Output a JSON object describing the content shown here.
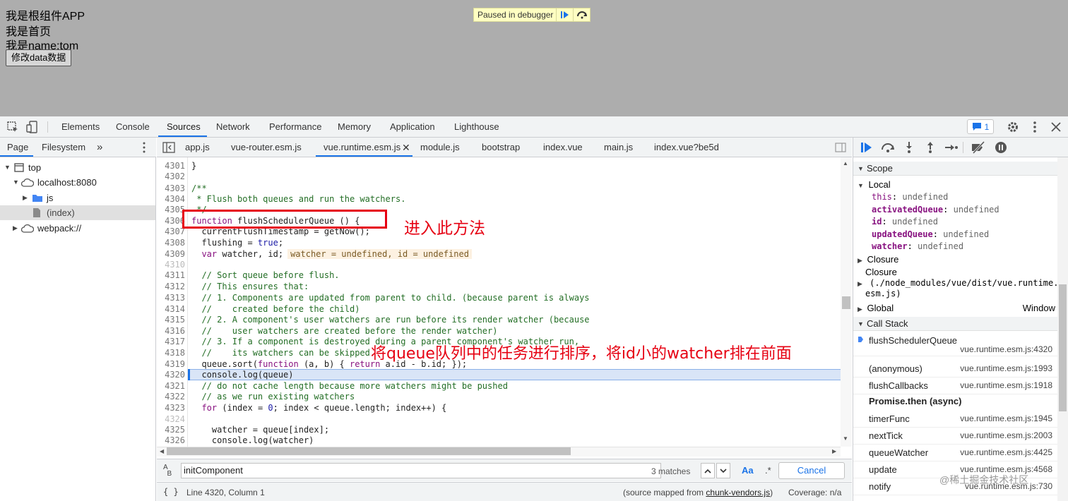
{
  "page": {
    "lines": [
      "我是根组件APP",
      "我是首页",
      "我是name:tom"
    ],
    "button_label": "修改data数据",
    "paused_banner": "Paused in debugger"
  },
  "devtools": {
    "tabs": [
      "Elements",
      "Console",
      "Sources",
      "Network",
      "Performance",
      "Memory",
      "Application",
      "Lighthouse"
    ],
    "active_tab": "Sources",
    "issues_count": "1"
  },
  "navigator": {
    "tabs": [
      "Page",
      "Filesystem"
    ],
    "more": "»",
    "tree": [
      {
        "label": "top"
      },
      {
        "label": "localhost:8080"
      },
      {
        "label": "js"
      },
      {
        "label": "(index)"
      },
      {
        "label": "webpack://"
      }
    ]
  },
  "editor": {
    "tabs": [
      "app.js",
      "vue-router.esm.js",
      "vue.runtime.esm.js",
      "module.js",
      "bootstrap",
      "index.vue",
      "main.js",
      "index.vue?be5d"
    ],
    "active_tab": "vue.runtime.esm.js",
    "lines": [
      {
        "n": "4301",
        "t": "}"
      },
      {
        "n": "4302",
        "t": ""
      },
      {
        "n": "4303",
        "t": "/**"
      },
      {
        "n": "4304",
        "t": " * Flush both queues and run the watchers."
      },
      {
        "n": "4305",
        "t": " */"
      },
      {
        "n": "4306",
        "t": "function flushSchedulerQueue () {"
      },
      {
        "n": "4307",
        "t": "  currentFlushTimestamp = getNow();"
      },
      {
        "n": "4308",
        "t": "  flushing = true;"
      },
      {
        "n": "4309",
        "t": "  var watcher, id;"
      },
      {
        "n": "4310",
        "t": ""
      },
      {
        "n": "4311",
        "t": "  // Sort queue before flush."
      },
      {
        "n": "4312",
        "t": "  // This ensures that:"
      },
      {
        "n": "4313",
        "t": "  // 1. Components are updated from parent to child. (because parent is always"
      },
      {
        "n": "4314",
        "t": "  //    created before the child)"
      },
      {
        "n": "4315",
        "t": "  // 2. A component's user watchers are run before its render watcher (because"
      },
      {
        "n": "4316",
        "t": "  //    user watchers are created before the render watcher)"
      },
      {
        "n": "4317",
        "t": "  // 3. If a component is destroyed during a parent component's watcher run,"
      },
      {
        "n": "4318",
        "t": "  //    its watchers can be skipped."
      },
      {
        "n": "4319",
        "t": "  queue.sort(function (a, b) { return a.id - b.id; });"
      },
      {
        "n": "4320",
        "t": "  console.log(queue)"
      },
      {
        "n": "4321",
        "t": "  // do not cache length because more watchers might be pushed"
      },
      {
        "n": "4322",
        "t": "  // as we run existing watchers"
      },
      {
        "n": "4323",
        "t": "  for (index = 0; index < queue.length; index++) {"
      },
      {
        "n": "4324",
        "t": ""
      },
      {
        "n": "4325",
        "t": "    watcher = queue[index];"
      },
      {
        "n": "4326",
        "t": "    console.log(watcher)"
      }
    ],
    "inline_value": "watcher = undefined, id = undefined"
  },
  "search": {
    "value": "initComponent",
    "matches": "3 matches",
    "case_label": "Aa",
    "regex_label": ".*",
    "cancel_label": "Cancel"
  },
  "status": {
    "position": "Line 4320, Column 1",
    "source_map_prefix": "(source mapped from ",
    "source_map_file": "chunk-vendors.js",
    "source_map_suffix": ")",
    "coverage": "Coverage: n/a"
  },
  "scope": {
    "header": "Scope",
    "local_header": "Local",
    "locals": [
      {
        "name": "this",
        "value": "undefined",
        "bold": false
      },
      {
        "name": "activatedQueue",
        "value": "undefined",
        "bold": true
      },
      {
        "name": "id",
        "value": "undefined",
        "bold": true
      },
      {
        "name": "updatedQueue",
        "value": "undefined",
        "bold": true
      },
      {
        "name": "watcher",
        "value": "undefined",
        "bold": true
      }
    ],
    "closure1": "Closure",
    "closure2_title": "Closure",
    "closure2_line1": "(./node_modules/vue/dist/vue.runtime.",
    "closure2_line2": "esm.js)",
    "global": "Global",
    "global_value": "Window"
  },
  "call_stack": {
    "header": "Call Stack",
    "frames": [
      {
        "fn": "flushSchedulerQueue",
        "loc": "vue.runtime.esm.js:4320"
      },
      {
        "fn": "(anonymous)",
        "loc": "vue.runtime.esm.js:1993"
      },
      {
        "fn": "flushCallbacks",
        "loc": "vue.runtime.esm.js:1918"
      },
      {
        "fn": "timerFunc",
        "loc": "vue.runtime.esm.js:1945"
      },
      {
        "fn": "nextTick",
        "loc": "vue.runtime.esm.js:2003"
      },
      {
        "fn": "queueWatcher",
        "loc": "vue.runtime.esm.js:4425"
      },
      {
        "fn": "update",
        "loc": "vue.runtime.esm.js:4568"
      },
      {
        "fn": "notify",
        "loc": "vue.runtime.esm.js:730"
      }
    ],
    "async_label": "Promise.then (async)"
  },
  "annotations": {
    "enter_method": "进入此方法",
    "sort_note": "将queue队列中的任务进行排序，将id小的watcher排在前面",
    "watermark": "@稀土掘金技术社区"
  },
  "colors": {
    "accent": "#1a73e8",
    "annotation": "#e60012"
  }
}
